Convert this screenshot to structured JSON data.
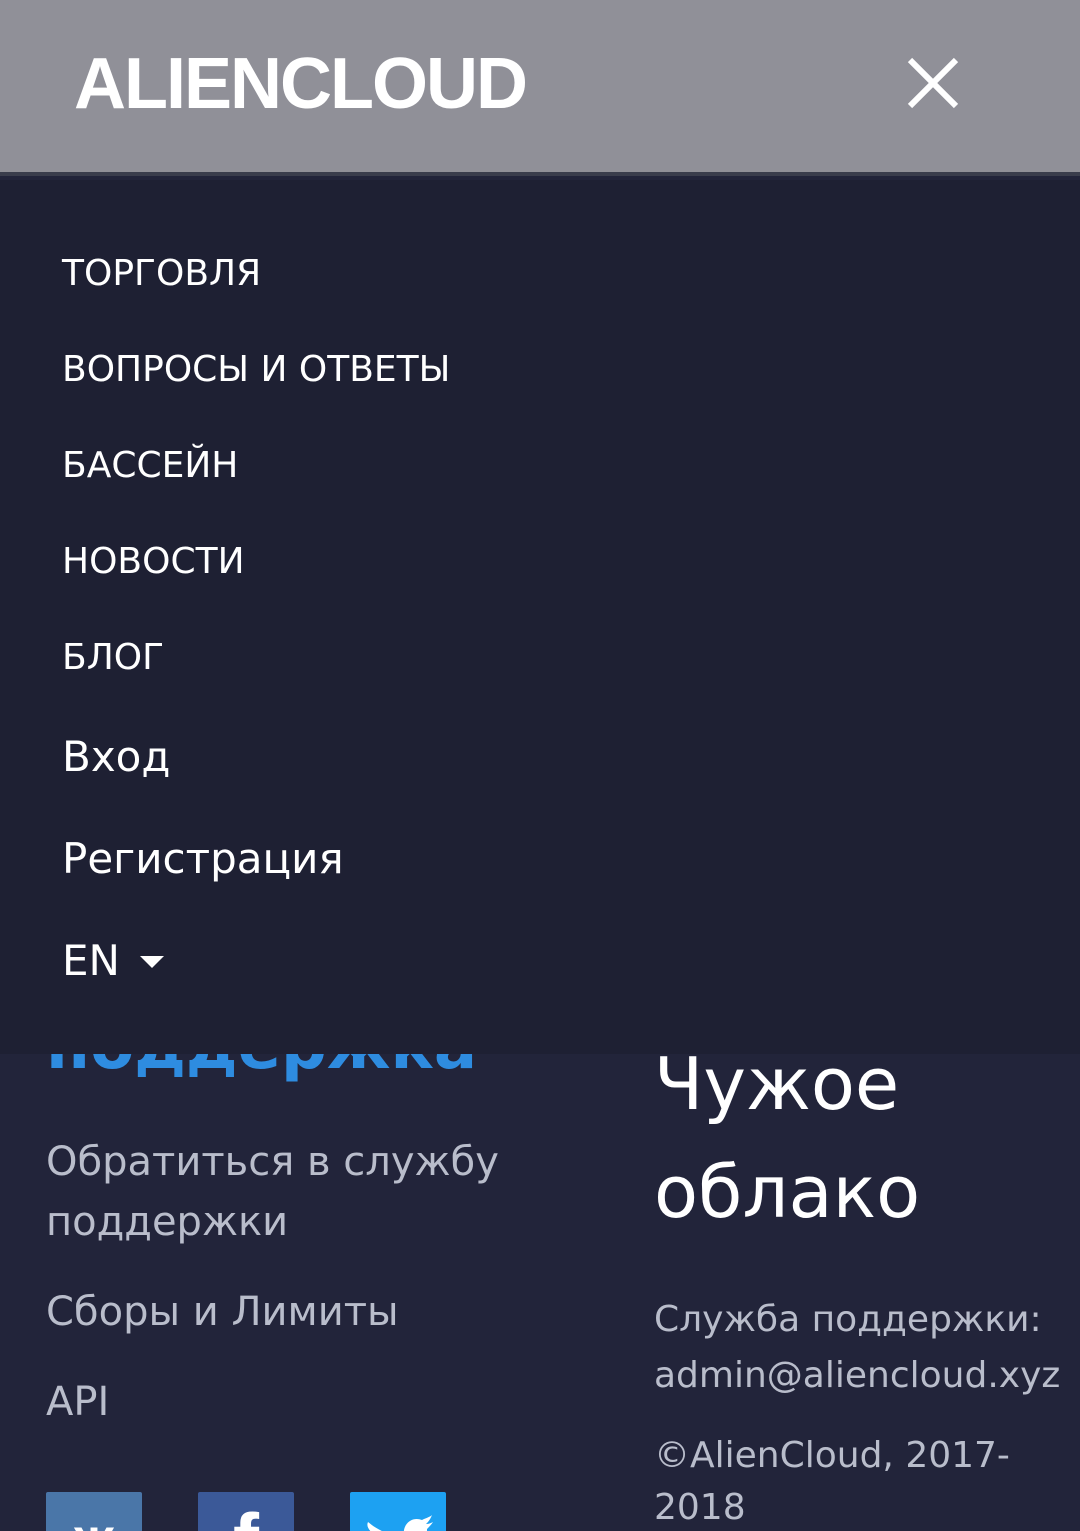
{
  "header": {
    "logo": "ALIENCLOUD",
    "close_icon": "close-icon"
  },
  "nav": {
    "items": [
      {
        "label": "ТОРГОВЛЯ"
      },
      {
        "label": "ВОПРОСЫ И ОТВЕТЫ"
      },
      {
        "label": "БАССЕЙН"
      },
      {
        "label": "НОВОСТИ"
      },
      {
        "label": "БЛОГ"
      },
      {
        "label": "Вход"
      },
      {
        "label": "Регистрация"
      }
    ],
    "language": {
      "label": "EN",
      "icon": "caret-down-icon"
    }
  },
  "footer": {
    "support_heading": "поддержка",
    "links": [
      {
        "label": "Обратиться в службу поддержки"
      },
      {
        "label": "Сборы и Лимиты"
      },
      {
        "label": "API"
      }
    ],
    "brand_title": "Чужое облако",
    "support_label": "Служба поддержки:",
    "support_email": "admin@aliencloud.xyz",
    "copyright": "©AlienCloud, 2017-2018",
    "social": [
      {
        "name": "vk-icon",
        "color": "#4a76a8"
      },
      {
        "name": "facebook-icon",
        "color": "#3b5998"
      },
      {
        "name": "twitter-icon",
        "color": "#1da1f2"
      }
    ]
  },
  "colors": {
    "header_bg": "#909098",
    "drawer_bg": "#1e2033",
    "page_bg": "#22243a",
    "accent": "#2e8ce0"
  }
}
